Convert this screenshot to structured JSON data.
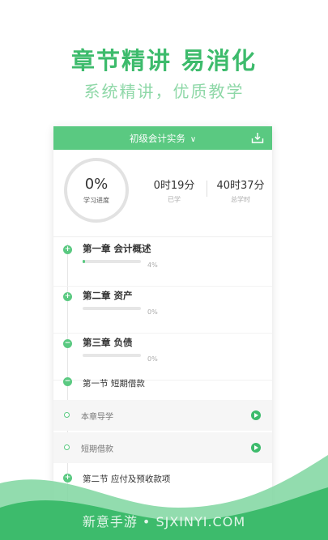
{
  "promo": {
    "headline": "章节精讲  易消化",
    "subline": "系统精讲，优质教学"
  },
  "header": {
    "course": "初级会计实务"
  },
  "stats": {
    "progress_pct": "0%",
    "progress_label": "学习进度",
    "learned_value": "0时19分",
    "learned_label": "已学",
    "total_value": "40时37分",
    "total_label": "总学时"
  },
  "chapters": [
    {
      "title": "第一章 会计概述",
      "pct": "4%",
      "progress": 0.04
    },
    {
      "title": "第二章 资产",
      "pct": "0%",
      "progress": 0
    },
    {
      "title": "第三章 负债",
      "pct": "0%",
      "progress": 0
    }
  ],
  "sections": [
    {
      "title": "第一节 短期借款"
    },
    {
      "title": "第二节 应付及预收款项"
    }
  ],
  "lessons": [
    {
      "title": "本章导学"
    },
    {
      "title": "短期借款"
    }
  ],
  "watermark": "新意手游 • SJXINYI.COM",
  "colors": {
    "accent": "#5ac981",
    "headline": "#3dbb6c",
    "subline": "#8fd8a8"
  }
}
